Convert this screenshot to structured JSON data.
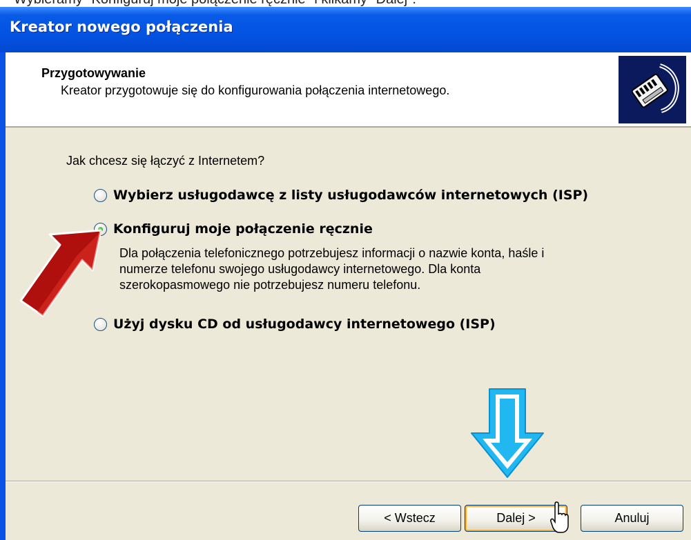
{
  "caption": "Wybieramy \"Konfiguruj moje połączenie ręcznie\" i klikamy \"Dalej\".",
  "window": {
    "title": "Kreator nowego połączenia"
  },
  "header": {
    "title": "Przygotowywanie",
    "subtitle": "Kreator przygotowuje się do konfigurowania połączenia internetowego.",
    "icon": "network-cable-icon"
  },
  "question": "Jak chcesz się łączyć z Internetem?",
  "options": [
    {
      "label": "Wybierz usługodawcę z listy usługodawców internetowych (ISP)",
      "checked": false
    },
    {
      "label": "Konfiguruj moje połączenie ręcznie",
      "checked": true
    },
    {
      "label": "Użyj dysku CD od usługodawcy internetowego (ISP)",
      "checked": false
    }
  ],
  "description": [
    "Dla połączenia telefonicznego potrzebujesz informacji o nazwie konta, haśle i",
    "numerze telefonu swojego usługodawcy internetowego. Dla konta",
    "szerokopasmowego nie potrzebujesz numeru telefonu."
  ],
  "buttons": {
    "back": "< Wstecz",
    "next": "Dalej >",
    "cancel": "Anuluj"
  },
  "colors": {
    "title_bar": "#0353e2",
    "dialog": "#ece9d8",
    "red_arrow": "#b0100d",
    "blue_arrow": "#21b7f0"
  }
}
